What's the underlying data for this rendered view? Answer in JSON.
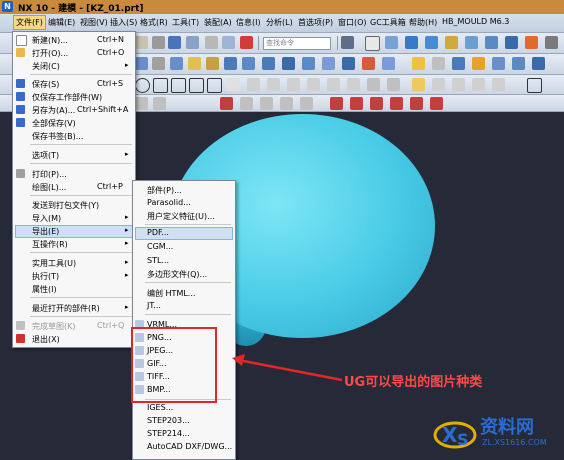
{
  "titlebar": {
    "title": "NX 10 - 建模 - [KZ_01.prt]"
  },
  "menubar": {
    "items": [
      "文件(F)",
      "编辑(E)",
      "视图(V)",
      "插入(S)",
      "格式(R)",
      "工具(T)",
      "装配(A)",
      "信息(I)",
      "分析(L)",
      "首选项(P)",
      "窗口(O)",
      "GC工具箱",
      "帮助(H)",
      "HB_MOULD M6.3"
    ]
  },
  "toolbar": {
    "search_placeholder": "查找命令"
  },
  "file_menu": {
    "items": [
      {
        "label": "新建(N)...",
        "shortcut": "Ctrl+N"
      },
      {
        "label": "打开(O)...",
        "shortcut": "Ctrl+O"
      },
      {
        "label": "关闭(C)",
        "shortcut": ""
      },
      {
        "label": "保存(S)",
        "shortcut": "Ctrl+S"
      },
      {
        "label": "仅保存工作部件(W)",
        "shortcut": ""
      },
      {
        "label": "另存为(A)...",
        "shortcut": "Ctrl+Shift+A"
      },
      {
        "label": "全部保存(V)",
        "shortcut": ""
      },
      {
        "label": "保存书签(B)...",
        "shortcut": ""
      },
      {
        "label": "选项(T)",
        "shortcut": ""
      },
      {
        "label": "打印(P)...",
        "shortcut": ""
      },
      {
        "label": "绘图(L)...",
        "shortcut": "Ctrl+P"
      },
      {
        "label": "发送到打包文件(Y)",
        "shortcut": ""
      },
      {
        "label": "导入(M)",
        "shortcut": ""
      },
      {
        "label": "导出(E)",
        "shortcut": ""
      },
      {
        "label": "互操作(R)",
        "shortcut": ""
      },
      {
        "label": "实用工具(U)",
        "shortcut": ""
      },
      {
        "label": "执行(T)",
        "shortcut": ""
      },
      {
        "label": "属性(I)",
        "shortcut": ""
      },
      {
        "label": "最近打开的部件(R)",
        "shortcut": ""
      },
      {
        "label": "完成草图(K)",
        "shortcut": "Ctrl+Q"
      },
      {
        "label": "退出(X)",
        "shortcut": ""
      }
    ]
  },
  "export_menu": {
    "items": [
      "部件(P)...",
      "Parasolid...",
      "用户定义特征(U)...",
      "PDF...",
      "CGM...",
      "STL...",
      "多边形文件(Q)...",
      "编创 HTML...",
      "JT...",
      "VRML...",
      "PNG...",
      "JPEG...",
      "GIF...",
      "TIFF...",
      "BMP...",
      "IGES...",
      "STEP203...",
      "STEP214...",
      "AutoCAD DXF/DWG..."
    ]
  },
  "annotation": {
    "text": "UG可以导出的图片种类"
  },
  "watermark": {
    "brand": "资料网",
    "url": "ZL.XS1616.COM"
  },
  "colors": {
    "part": "#48cbe6",
    "annotation": "#e02727",
    "highlight": "#cfe0f5"
  }
}
